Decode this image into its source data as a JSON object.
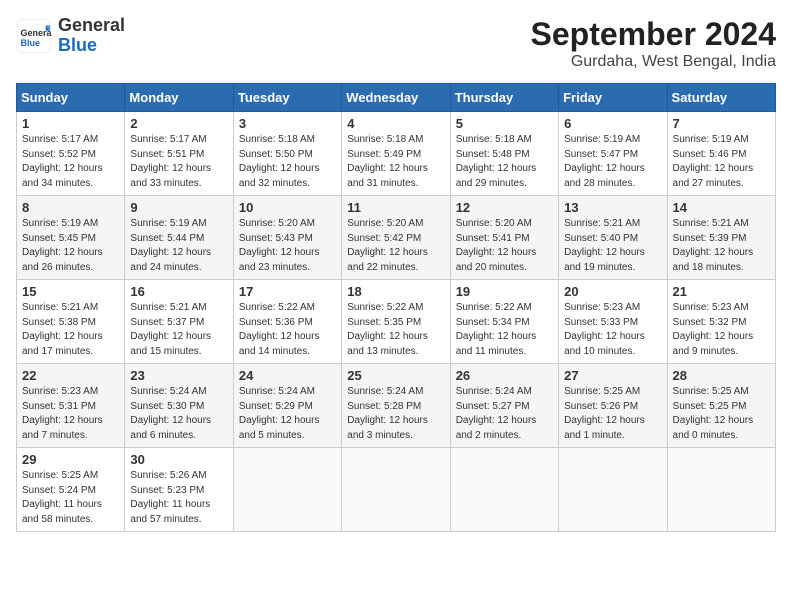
{
  "header": {
    "logo_general": "General",
    "logo_blue": "Blue",
    "month": "September 2024",
    "location": "Gurdaha, West Bengal, India"
  },
  "weekdays": [
    "Sunday",
    "Monday",
    "Tuesday",
    "Wednesday",
    "Thursday",
    "Friday",
    "Saturday"
  ],
  "weeks": [
    [
      {
        "day": "1",
        "sunrise": "5:17 AM",
        "sunset": "5:52 PM",
        "daylight": "12 hours and 34 minutes."
      },
      {
        "day": "2",
        "sunrise": "5:17 AM",
        "sunset": "5:51 PM",
        "daylight": "12 hours and 33 minutes."
      },
      {
        "day": "3",
        "sunrise": "5:18 AM",
        "sunset": "5:50 PM",
        "daylight": "12 hours and 32 minutes."
      },
      {
        "day": "4",
        "sunrise": "5:18 AM",
        "sunset": "5:49 PM",
        "daylight": "12 hours and 31 minutes."
      },
      {
        "day": "5",
        "sunrise": "5:18 AM",
        "sunset": "5:48 PM",
        "daylight": "12 hours and 29 minutes."
      },
      {
        "day": "6",
        "sunrise": "5:19 AM",
        "sunset": "5:47 PM",
        "daylight": "12 hours and 28 minutes."
      },
      {
        "day": "7",
        "sunrise": "5:19 AM",
        "sunset": "5:46 PM",
        "daylight": "12 hours and 27 minutes."
      }
    ],
    [
      {
        "day": "8",
        "sunrise": "5:19 AM",
        "sunset": "5:45 PM",
        "daylight": "12 hours and 26 minutes."
      },
      {
        "day": "9",
        "sunrise": "5:19 AM",
        "sunset": "5:44 PM",
        "daylight": "12 hours and 24 minutes."
      },
      {
        "day": "10",
        "sunrise": "5:20 AM",
        "sunset": "5:43 PM",
        "daylight": "12 hours and 23 minutes."
      },
      {
        "day": "11",
        "sunrise": "5:20 AM",
        "sunset": "5:42 PM",
        "daylight": "12 hours and 22 minutes."
      },
      {
        "day": "12",
        "sunrise": "5:20 AM",
        "sunset": "5:41 PM",
        "daylight": "12 hours and 20 minutes."
      },
      {
        "day": "13",
        "sunrise": "5:21 AM",
        "sunset": "5:40 PM",
        "daylight": "12 hours and 19 minutes."
      },
      {
        "day": "14",
        "sunrise": "5:21 AM",
        "sunset": "5:39 PM",
        "daylight": "12 hours and 18 minutes."
      }
    ],
    [
      {
        "day": "15",
        "sunrise": "5:21 AM",
        "sunset": "5:38 PM",
        "daylight": "12 hours and 17 minutes."
      },
      {
        "day": "16",
        "sunrise": "5:21 AM",
        "sunset": "5:37 PM",
        "daylight": "12 hours and 15 minutes."
      },
      {
        "day": "17",
        "sunrise": "5:22 AM",
        "sunset": "5:36 PM",
        "daylight": "12 hours and 14 minutes."
      },
      {
        "day": "18",
        "sunrise": "5:22 AM",
        "sunset": "5:35 PM",
        "daylight": "12 hours and 13 minutes."
      },
      {
        "day": "19",
        "sunrise": "5:22 AM",
        "sunset": "5:34 PM",
        "daylight": "12 hours and 11 minutes."
      },
      {
        "day": "20",
        "sunrise": "5:23 AM",
        "sunset": "5:33 PM",
        "daylight": "12 hours and 10 minutes."
      },
      {
        "day": "21",
        "sunrise": "5:23 AM",
        "sunset": "5:32 PM",
        "daylight": "12 hours and 9 minutes."
      }
    ],
    [
      {
        "day": "22",
        "sunrise": "5:23 AM",
        "sunset": "5:31 PM",
        "daylight": "12 hours and 7 minutes."
      },
      {
        "day": "23",
        "sunrise": "5:24 AM",
        "sunset": "5:30 PM",
        "daylight": "12 hours and 6 minutes."
      },
      {
        "day": "24",
        "sunrise": "5:24 AM",
        "sunset": "5:29 PM",
        "daylight": "12 hours and 5 minutes."
      },
      {
        "day": "25",
        "sunrise": "5:24 AM",
        "sunset": "5:28 PM",
        "daylight": "12 hours and 3 minutes."
      },
      {
        "day": "26",
        "sunrise": "5:24 AM",
        "sunset": "5:27 PM",
        "daylight": "12 hours and 2 minutes."
      },
      {
        "day": "27",
        "sunrise": "5:25 AM",
        "sunset": "5:26 PM",
        "daylight": "12 hours and 1 minute."
      },
      {
        "day": "28",
        "sunrise": "5:25 AM",
        "sunset": "5:25 PM",
        "daylight": "12 hours and 0 minutes."
      }
    ],
    [
      {
        "day": "29",
        "sunrise": "5:25 AM",
        "sunset": "5:24 PM",
        "daylight": "11 hours and 58 minutes."
      },
      {
        "day": "30",
        "sunrise": "5:26 AM",
        "sunset": "5:23 PM",
        "daylight": "11 hours and 57 minutes."
      },
      null,
      null,
      null,
      null,
      null
    ]
  ]
}
